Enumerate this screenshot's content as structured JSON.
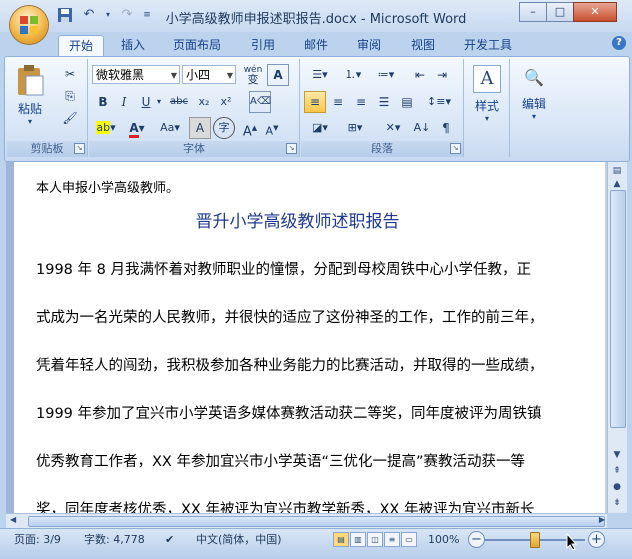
{
  "window": {
    "title": "小学高级教师申报述职报告.docx - Microsoft Word",
    "controls": {
      "minimize": "–",
      "maximize": "□",
      "close": "✕"
    }
  },
  "quick_access": {
    "save_icon": "save-icon",
    "undo_icon": "undo-icon",
    "redo_icon": "redo-icon",
    "customize_icon": "qat-customize-icon"
  },
  "tabs": [
    "开始",
    "插入",
    "页面布局",
    "引用",
    "邮件",
    "审阅",
    "视图",
    "开发工具"
  ],
  "ribbon": {
    "clipboard": {
      "label": "剪贴板",
      "paste": "粘贴"
    },
    "font": {
      "label": "字体",
      "font_name": "微软雅黑",
      "font_size": "小四",
      "wen": "wén",
      "wen_char": "变"
    },
    "paragraph": {
      "label": "段落"
    },
    "styles": {
      "label": "样式"
    },
    "editing": {
      "label": "编辑"
    }
  },
  "document": {
    "first_line": "本人申报小学高级教师。",
    "heading": "晋升小学高级教师述职报告",
    "lines": [
      "1998 年 8 月我满怀着对教师职业的憧憬，分配到母校周铁中心小学任教，正",
      "式成为一名光荣的人民教师，并很快的适应了这份神圣的工作，工作的前三年，",
      "凭着年轻人的闯劲，我积极参加各种业务能力的比赛活动，并取得的一些成绩，",
      "1999 年参加了宜兴市小学英语多媒体赛教活动获二等奖，同年度被评为周铁镇",
      "优秀教育工作者，XX 年参加宜兴市小学英语“三优化一提高”赛教活动获一等",
      "奖，同年度考核优秀，XX 年被评为宜兴市教学新秀，XX 年被评为宜兴市新长"
    ]
  },
  "statusbar": {
    "page": "页面: 3/9",
    "words": "字数: 4,778",
    "language": "中文(简体，中国)",
    "zoom": "100%",
    "zoom_minus": "−",
    "zoom_plus": "+"
  },
  "colors": {
    "accent": "#15428b",
    "heading": "#1f3a93",
    "ribbon_bg": "#d7e5f6"
  }
}
